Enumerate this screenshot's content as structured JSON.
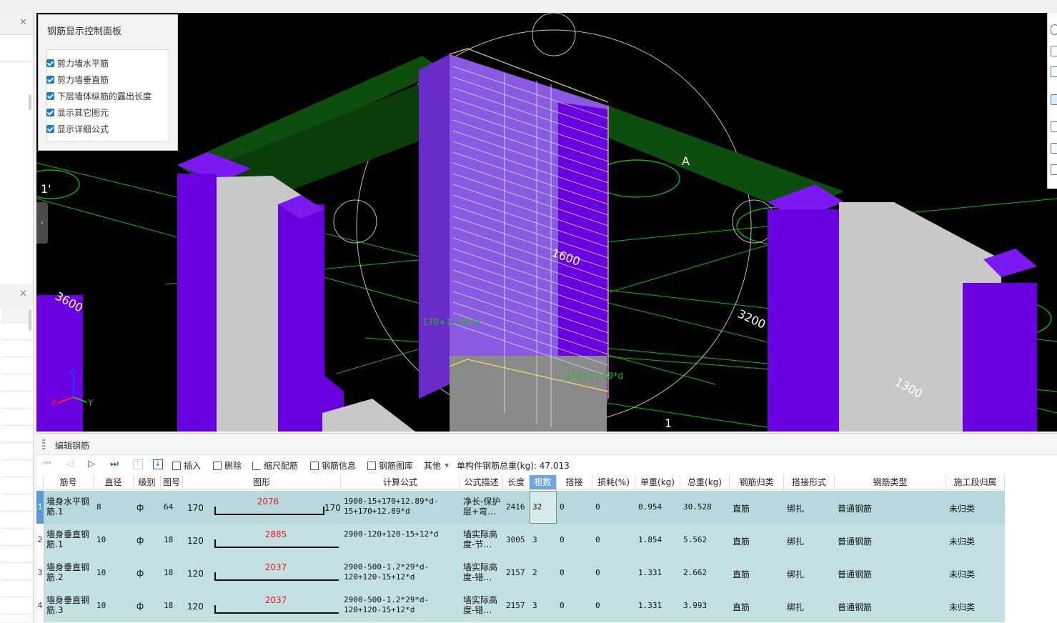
{
  "panel": {
    "title": "钢筋显示控制面板",
    "checkboxes": [
      {
        "label": "剪力墙水平筋",
        "checked": true
      },
      {
        "label": "剪力墙垂直筋",
        "checked": true
      },
      {
        "label": "下层墙体纵筋的露出长度",
        "checked": true
      },
      {
        "label": "显示其它图元",
        "checked": true
      },
      {
        "label": "显示详细公式",
        "checked": true
      }
    ]
  },
  "viewport": {
    "labels": {
      "axis_a": "A",
      "axis_1": "1",
      "axis_1_left": "1'",
      "dim_1600": "1600",
      "dim_3200": "3200",
      "dim_1300": "1300",
      "dim_3600": "3600",
      "formula_hint1": "170+12.89*d",
      "formula_hint2": "170+12.89*d",
      "axis_z": "Z",
      "axis_x": "X",
      "axis_y": "Y"
    },
    "colors": {
      "column": "#6a00e0",
      "wall": "#c8c8c8",
      "beam": "#0d4d0d",
      "grid": "#00d000"
    }
  },
  "editor": {
    "title": "编辑钢筋",
    "toolbar": {
      "insert": "插入",
      "delete": "删除",
      "scale_rebar": "缩尺配筋",
      "rebar_info": "钢筋信息",
      "rebar_library": "钢筋图库",
      "other": "其他",
      "total_label": "单构件钢筋总重(kg): 47.013"
    },
    "columns": [
      "筋号",
      "直径(mm)",
      "级别",
      "图号",
      "图形",
      "计算公式",
      "公式描述",
      "长度",
      "根数",
      "搭接",
      "损耗(%)",
      "单重(kg)",
      "总重(kg)",
      "钢筋归类",
      "搭接形式",
      "钢筋类型",
      "施工段归属"
    ],
    "rows": [
      {
        "num": "1",
        "name": "墙身水平钢筋.1",
        "dia": "8",
        "grade": "ф",
        "fig": "64",
        "shape_left": "170",
        "shape_mid": "2076",
        "shape_right": "170",
        "formula": "1900-15+170+12.89*d-15+170+12.89*d",
        "desc": "净长-保护层+弯…",
        "length": "2416",
        "count": "32",
        "lap": "0",
        "loss": "0",
        "unit_wt": "0.954",
        "total_wt": "30.528",
        "category": "直筋",
        "lap_type": "绑扎",
        "rebar_type": "普通钢筋",
        "stage": "未归类"
      },
      {
        "num": "2",
        "name": "墙身垂直钢筋.1",
        "dia": "10",
        "grade": "ф",
        "fig": "18",
        "shape_left": "120",
        "shape_mid": "2885",
        "shape_right": "",
        "formula": "2900-120+120-15+12*d",
        "desc": "墙实际高度-节…",
        "length": "3005",
        "count": "3",
        "lap": "0",
        "loss": "0",
        "unit_wt": "1.854",
        "total_wt": "5.562",
        "category": "直筋",
        "lap_type": "绑扎",
        "rebar_type": "普通钢筋",
        "stage": "未归类"
      },
      {
        "num": "3",
        "name": "墙身垂直钢筋.2",
        "dia": "10",
        "grade": "ф",
        "fig": "18",
        "shape_left": "120",
        "shape_mid": "2037",
        "shape_right": "",
        "formula": "2900-500-1.2*29*d-120+120-15+12*d",
        "desc": "墙实际高度-错…",
        "length": "2157",
        "count": "2",
        "lap": "0",
        "loss": "0",
        "unit_wt": "1.331",
        "total_wt": "2.662",
        "category": "直筋",
        "lap_type": "绑扎",
        "rebar_type": "普通钢筋",
        "stage": "未归类"
      },
      {
        "num": "4",
        "name": "墙身垂直钢筋.3",
        "dia": "10",
        "grade": "ф",
        "fig": "18",
        "shape_left": "120",
        "shape_mid": "2037",
        "shape_right": "",
        "formula": "2900-500-1.2*29*d-120+120-15+12*d",
        "desc": "墙实际高度-错…",
        "length": "2157",
        "count": "3",
        "lap": "0",
        "loss": "0",
        "unit_wt": "1.331",
        "total_wt": "3.993",
        "category": "直筋",
        "lap_type": "绑扎",
        "rebar_type": "普通钢筋",
        "stage": "未归类"
      }
    ]
  }
}
